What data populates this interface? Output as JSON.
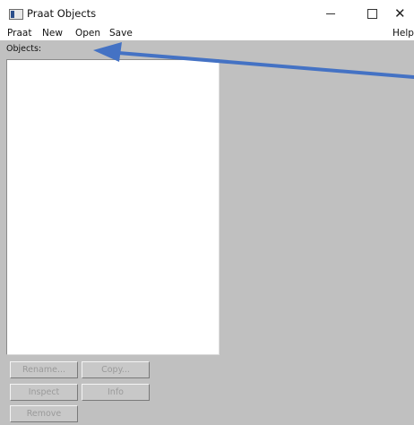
{
  "window": {
    "title": "Praat Objects",
    "icon": "praat-app-icon"
  },
  "window_controls": {
    "minimize": "minimize-icon",
    "maximize": "maximize-icon",
    "close_glyph": "✕"
  },
  "menubar": {
    "items": [
      "Praat",
      "New",
      "Open",
      "Save"
    ],
    "help": "Help"
  },
  "objects_panel": {
    "label": "Objects:",
    "items": []
  },
  "buttons": {
    "rename": "Rename...",
    "copy": "Copy...",
    "inspect": "Inspect",
    "info": "Info",
    "remove": "Remove",
    "disabled": true
  },
  "annotation": {
    "type": "arrow",
    "color": "#4472c4",
    "points_to": "Open"
  }
}
